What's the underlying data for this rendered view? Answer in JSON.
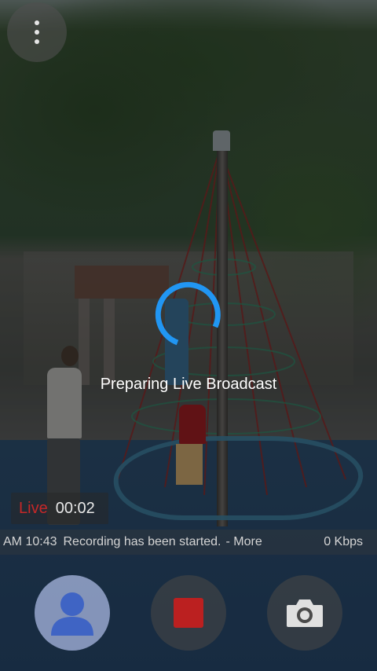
{
  "overlay": {
    "status_text": "Preparing Live Broadcast"
  },
  "live": {
    "label": "Live",
    "elapsed": "00:02"
  },
  "log": {
    "time": "AM 10:43",
    "message": "Recording has been started.",
    "more": "- More",
    "bitrate": "0 Kbps"
  },
  "icons": {
    "menu": "more-vertical-icon",
    "spinner": "loading-spinner-icon",
    "profile": "person-icon",
    "record": "record-stop-icon",
    "camera": "camera-icon"
  },
  "colors": {
    "live_red": "#c62828",
    "spinner_blue": "#2196f3",
    "record_red": "#bb2020",
    "profile_blue": "#3f64c4"
  }
}
